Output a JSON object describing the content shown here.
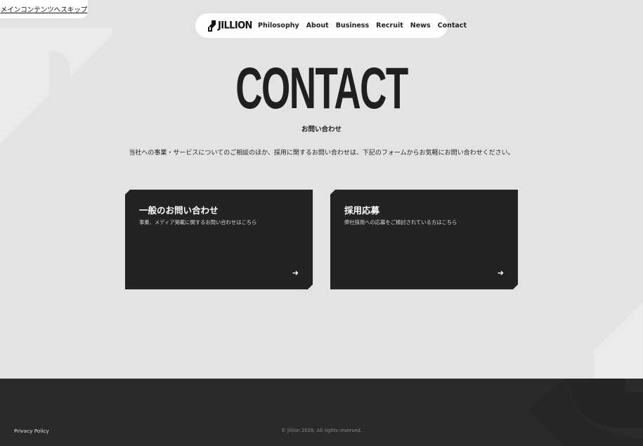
{
  "skip_link": "メインコンテンツへスキップ",
  "header": {
    "logo_text": "JILLION",
    "nav": [
      {
        "label": "Philosophy"
      },
      {
        "label": "About"
      },
      {
        "label": "Business"
      },
      {
        "label": "Recruit"
      },
      {
        "label": "News"
      },
      {
        "label": "Contact"
      }
    ]
  },
  "hero": {
    "title": "CONTACT",
    "subtitle": "お問い合わせ"
  },
  "lead": "当社への事業・サービスについてのご相談のほか、採用に関するお問い合わせは、下記のフォームからお気軽にお問い合わせください。",
  "cards": [
    {
      "title": "一般のお問い合わせ",
      "description": "事業、メディア掲載に関するお問い合わせはこちら",
      "arrow": "➜"
    },
    {
      "title": "採用応募",
      "description": "弊社採用への応募をご検討されている方はこちら",
      "arrow": "➜"
    }
  ],
  "footer": {
    "privacy": "Privacy Policy",
    "copyright": "© Jillion 2026, All rights reserved."
  },
  "colors": {
    "background": "#e3e3e3",
    "card": "#232323",
    "footer": "#2a2a2a",
    "accent_white": "#ffffff"
  }
}
